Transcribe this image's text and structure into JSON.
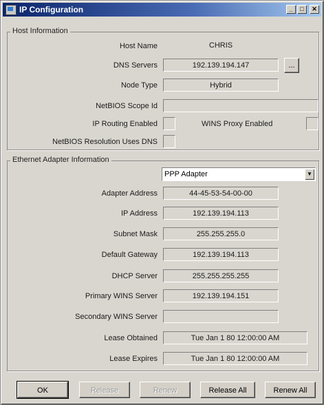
{
  "window": {
    "title": "IP Configuration",
    "controls": {
      "minimize": "_",
      "maximize": "□",
      "close": "✕"
    }
  },
  "host": {
    "group_title": "Host Information",
    "host_name_label": "Host Name",
    "host_name": "CHRIS",
    "dns_servers_label": "DNS Servers",
    "dns_servers": "192.139.194.147",
    "dns_more_label": "...",
    "node_type_label": "Node Type",
    "node_type": "Hybrid",
    "netbios_scope_label": "NetBIOS Scope Id",
    "netbios_scope": "",
    "ip_routing_label": "IP Routing Enabled",
    "wins_proxy_label": "WINS Proxy Enabled",
    "netbios_dns_label": "NetBIOS Resolution Uses DNS"
  },
  "adapter": {
    "group_title": "Ethernet Adapter Information",
    "selected": "PPP Adapter",
    "address_label": "Adapter Address",
    "address": "44-45-53-54-00-00",
    "ip_label": "IP Address",
    "ip": "192.139.194.113",
    "subnet_label": "Subnet Mask",
    "subnet": "255.255.255.0",
    "gateway_label": "Default Gateway",
    "gateway": "192.139.194.113",
    "dhcp_label": "DHCP Server",
    "dhcp": "255.255.255.255",
    "primary_wins_label": "Primary WINS Server",
    "primary_wins": "192.139.194.151",
    "secondary_wins_label": "Secondary WINS Server",
    "secondary_wins": "",
    "lease_obtained_label": "Lease Obtained",
    "lease_obtained": "Tue Jan 1 80 12:00:00 AM",
    "lease_expires_label": "Lease Expires",
    "lease_expires": "Tue Jan 1 80 12:00:00 AM"
  },
  "buttons": {
    "ok": "OK",
    "release": "Release",
    "renew": "Renew",
    "release_all": "Release All",
    "renew_all": "Renew All"
  }
}
